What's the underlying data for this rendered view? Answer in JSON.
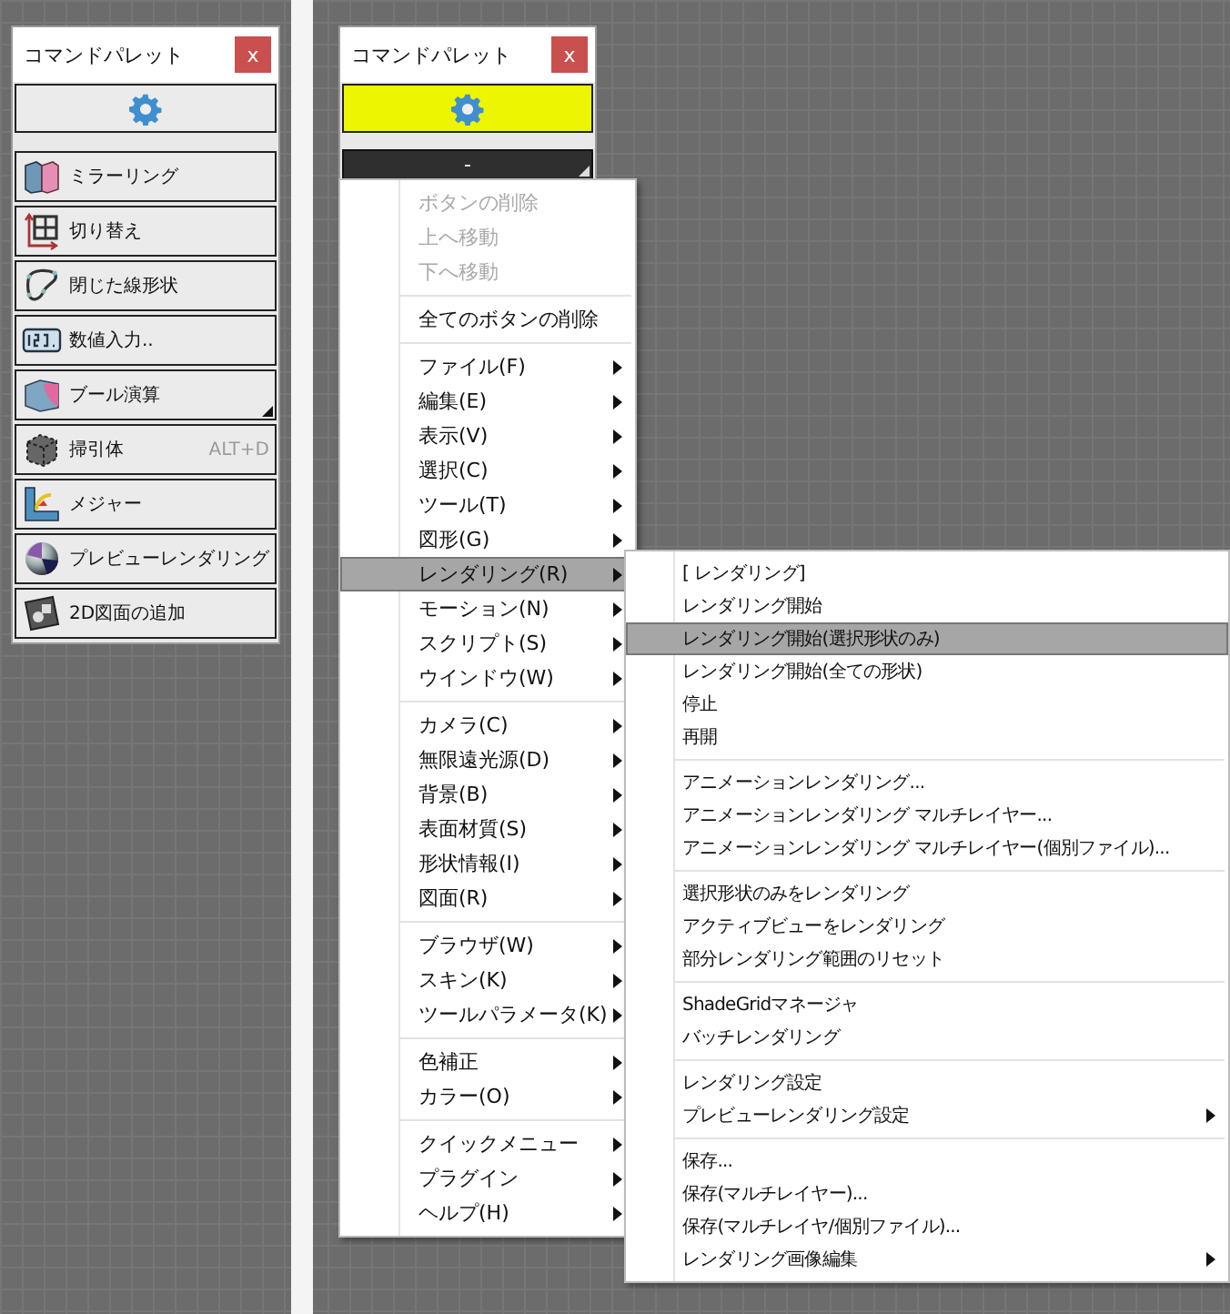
{
  "palettes": [
    {
      "title": "コマンドパレット",
      "close": "x",
      "gear_button": {
        "selected": false
      },
      "buttons": [
        {
          "label": "ミラーリング",
          "kind": "mirror",
          "dropdown": false
        },
        {
          "label": "切り替え",
          "kind": "switch",
          "dropdown": false
        },
        {
          "label": "閉じた線形状",
          "kind": "closed-curve",
          "dropdown": false
        },
        {
          "label": "数値入力..",
          "kind": "numeric",
          "dropdown": false
        },
        {
          "label": "ブール演算",
          "kind": "boolean",
          "dropdown": true
        },
        {
          "label": "掃引体",
          "kind": "sweep",
          "dropdown": false,
          "shortcut": "ALT+D"
        },
        {
          "label": "メジャー",
          "kind": "measure",
          "dropdown": false
        },
        {
          "label": "プレビューレンダリング",
          "kind": "preview",
          "dropdown": false
        },
        {
          "label": "2D図面の追加",
          "kind": "drawing",
          "dropdown": false
        }
      ]
    },
    {
      "title": "コマンドパレット",
      "close": "x",
      "gear_button": {
        "selected": true
      },
      "collapsed_bar": {
        "label": "-",
        "dropdown": true
      }
    }
  ],
  "context_menu": {
    "groups": [
      [
        {
          "label": "ボタンの削除",
          "disabled": true,
          "submenu": false,
          "selected": false
        },
        {
          "label": "上へ移動",
          "disabled": true,
          "submenu": false,
          "selected": false
        },
        {
          "label": "下へ移動",
          "disabled": true,
          "submenu": false,
          "selected": false
        }
      ],
      [
        {
          "label": "全てのボタンの削除",
          "disabled": false,
          "submenu": false,
          "selected": false
        }
      ],
      [
        {
          "label": "ファイル(F)",
          "disabled": false,
          "submenu": true,
          "selected": false
        },
        {
          "label": "編集(E)",
          "disabled": false,
          "submenu": true,
          "selected": false
        },
        {
          "label": "表示(V)",
          "disabled": false,
          "submenu": true,
          "selected": false
        },
        {
          "label": "選択(C)",
          "disabled": false,
          "submenu": true,
          "selected": false
        },
        {
          "label": "ツール(T)",
          "disabled": false,
          "submenu": true,
          "selected": false
        },
        {
          "label": "図形(G)",
          "disabled": false,
          "submenu": true,
          "selected": false
        },
        {
          "label": "レンダリング(R)",
          "disabled": false,
          "submenu": true,
          "selected": true
        },
        {
          "label": "モーション(N)",
          "disabled": false,
          "submenu": true,
          "selected": false
        },
        {
          "label": "スクリプト(S)",
          "disabled": false,
          "submenu": true,
          "selected": false
        },
        {
          "label": "ウインドウ(W)",
          "disabled": false,
          "submenu": true,
          "selected": false
        }
      ],
      [
        {
          "label": "カメラ(C)",
          "disabled": false,
          "submenu": true,
          "selected": false
        },
        {
          "label": "無限遠光源(D)",
          "disabled": false,
          "submenu": true,
          "selected": false
        },
        {
          "label": "背景(B)",
          "disabled": false,
          "submenu": true,
          "selected": false
        },
        {
          "label": "表面材質(S)",
          "disabled": false,
          "submenu": true,
          "selected": false
        },
        {
          "label": "形状情報(I)",
          "disabled": false,
          "submenu": true,
          "selected": false
        },
        {
          "label": "図面(R)",
          "disabled": false,
          "submenu": true,
          "selected": false
        }
      ],
      [
        {
          "label": "ブラウザ(W)",
          "disabled": false,
          "submenu": true,
          "selected": false
        },
        {
          "label": "スキン(K)",
          "disabled": false,
          "submenu": true,
          "selected": false
        },
        {
          "label": "ツールパラメータ(K)",
          "disabled": false,
          "submenu": true,
          "selected": false
        }
      ],
      [
        {
          "label": "色補正",
          "disabled": false,
          "submenu": true,
          "selected": false
        },
        {
          "label": "カラー(O)",
          "disabled": false,
          "submenu": true,
          "selected": false
        }
      ],
      [
        {
          "label": "クイックメニュー",
          "disabled": false,
          "submenu": true,
          "selected": false
        },
        {
          "label": "プラグイン",
          "disabled": false,
          "submenu": true,
          "selected": false
        },
        {
          "label": "ヘルプ(H)",
          "disabled": false,
          "submenu": true,
          "selected": false
        }
      ]
    ]
  },
  "submenu": {
    "groups": [
      [
        {
          "label": "[ レンダリング]",
          "disabled": false,
          "submenu": false,
          "selected": false
        },
        {
          "label": "レンダリング開始",
          "disabled": false,
          "submenu": false,
          "selected": false
        },
        {
          "label": "レンダリング開始(選択形状のみ)",
          "disabled": false,
          "submenu": false,
          "selected": true
        },
        {
          "label": "レンダリング開始(全ての形状)",
          "disabled": false,
          "submenu": false,
          "selected": false
        },
        {
          "label": "停止",
          "disabled": false,
          "submenu": false,
          "selected": false
        },
        {
          "label": "再開",
          "disabled": false,
          "submenu": false,
          "selected": false
        }
      ],
      [
        {
          "label": "アニメーションレンダリング...",
          "disabled": false,
          "submenu": false,
          "selected": false
        },
        {
          "label": "アニメーションレンダリング マルチレイヤー...",
          "disabled": false,
          "submenu": false,
          "selected": false
        },
        {
          "label": "アニメーションレンダリング マルチレイヤー(個別ファイル)...",
          "disabled": false,
          "submenu": false,
          "selected": false
        }
      ],
      [
        {
          "label": "選択形状のみをレンダリング",
          "disabled": false,
          "submenu": false,
          "selected": false
        },
        {
          "label": "アクティブビューをレンダリング",
          "disabled": false,
          "submenu": false,
          "selected": false
        },
        {
          "label": "部分レンダリング範囲のリセット",
          "disabled": false,
          "submenu": false,
          "selected": false
        }
      ],
      [
        {
          "label": "ShadeGridマネージャ",
          "disabled": false,
          "submenu": false,
          "selected": false
        },
        {
          "label": "バッチレンダリング",
          "disabled": false,
          "submenu": false,
          "selected": false
        }
      ],
      [
        {
          "label": "レンダリング設定",
          "disabled": false,
          "submenu": false,
          "selected": false
        },
        {
          "label": "プレビューレンダリング設定",
          "disabled": false,
          "submenu": true,
          "selected": false
        }
      ],
      [
        {
          "label": "保存...",
          "disabled": false,
          "submenu": false,
          "selected": false
        },
        {
          "label": "保存(マルチレイヤー)...",
          "disabled": false,
          "submenu": false,
          "selected": false
        },
        {
          "label": "保存(マルチレイヤ/個別ファイル)...",
          "disabled": false,
          "submenu": false,
          "selected": false
        },
        {
          "label": "レンダリング画像編集",
          "disabled": false,
          "submenu": true,
          "selected": false
        }
      ]
    ]
  }
}
